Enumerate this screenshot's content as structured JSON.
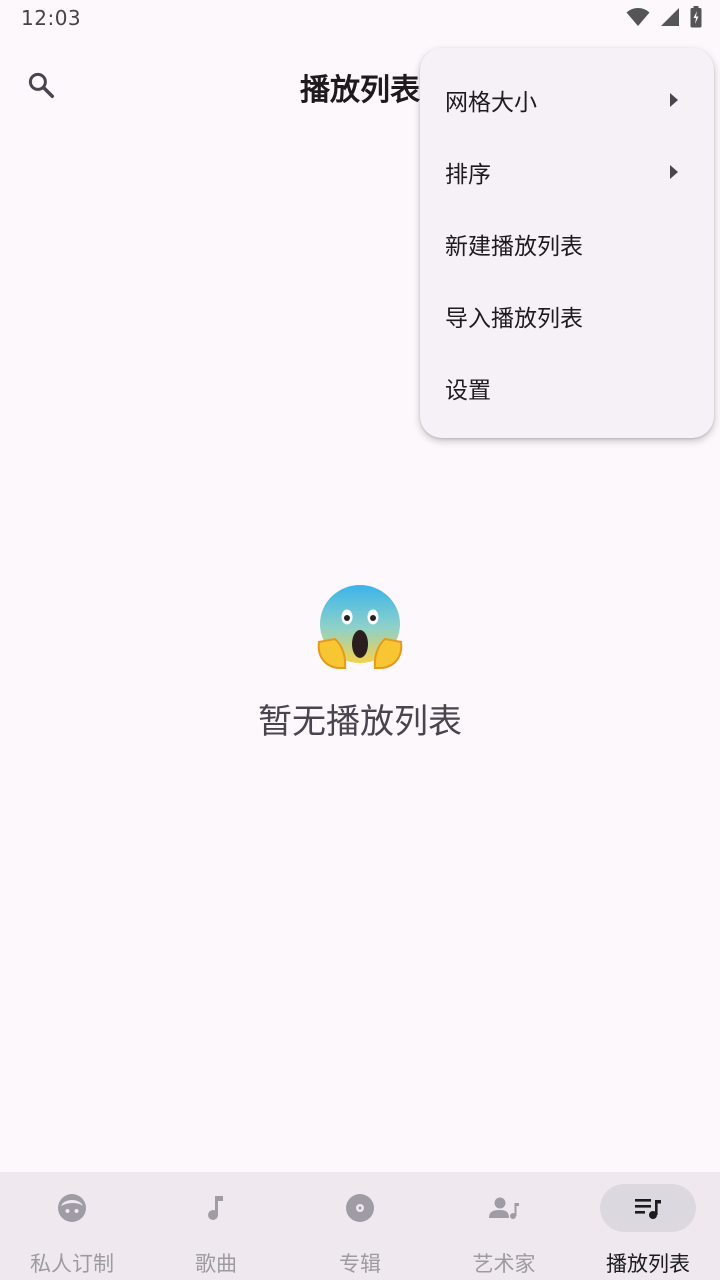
{
  "status_bar": {
    "time": "12:03",
    "icons": [
      "wifi-icon",
      "signal-icon",
      "battery-icon"
    ]
  },
  "top_bar": {
    "title": "播放列表",
    "search_icon": "search-icon"
  },
  "menu": {
    "items": [
      {
        "label": "网格大小",
        "has_submenu": true
      },
      {
        "label": "排序",
        "has_submenu": true
      },
      {
        "label": "新建播放列表",
        "has_submenu": false
      },
      {
        "label": "导入播放列表",
        "has_submenu": false
      },
      {
        "label": "设置",
        "has_submenu": false
      }
    ]
  },
  "empty_state": {
    "icon": "screaming-face-emoji",
    "message": "暂无播放列表"
  },
  "bottom_nav": {
    "items": [
      {
        "label": "私人订制",
        "icon": "face-icon",
        "active": false
      },
      {
        "label": "歌曲",
        "icon": "music-note-icon",
        "active": false
      },
      {
        "label": "专辑",
        "icon": "album-disc-icon",
        "active": false
      },
      {
        "label": "艺术家",
        "icon": "artist-icon",
        "active": false
      },
      {
        "label": "播放列表",
        "icon": "playlist-icon",
        "active": true
      }
    ]
  },
  "colors": {
    "background": "#fdf8fc",
    "menu_background": "#f6f1f6",
    "nav_background": "#efe9ef",
    "active_pill": "#dcd8e0",
    "inactive_icon": "#a09ca6",
    "active_icon": "#1d1b1e"
  }
}
